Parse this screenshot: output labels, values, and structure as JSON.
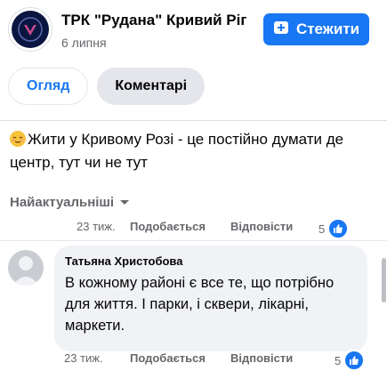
{
  "page": {
    "name": "ТРК \"Рудана\" Кривий Ріг",
    "date": "6 липня",
    "follow_label": "Стежити"
  },
  "tabs": [
    {
      "label": "Огляд",
      "active": false
    },
    {
      "label": "Коментарі",
      "active": true
    }
  ],
  "post": {
    "emoji": "relieved-face",
    "text": "Жити у Кривому Розі - це постійно думати де центр, тут чи не тут"
  },
  "sort": {
    "label": "Найактуальніші"
  },
  "post_meta": {
    "time": "23 тиж.",
    "like_label": "Подобається",
    "reply_label": "Відповісти",
    "reaction_count": "5"
  },
  "comments": [
    {
      "author": "Татьяна Христобова",
      "text": "В кожному районі є все те, що потрібно для життя. І парки, і сквери, лікарні, маркети.",
      "time": "23 тиж.",
      "like_label": "Подобається",
      "reply_label": "Відповісти",
      "reaction_count": "5"
    }
  ],
  "colors": {
    "accent": "#1877f2",
    "secondary_text": "#65676b",
    "bubble": "#f0f2f5"
  }
}
